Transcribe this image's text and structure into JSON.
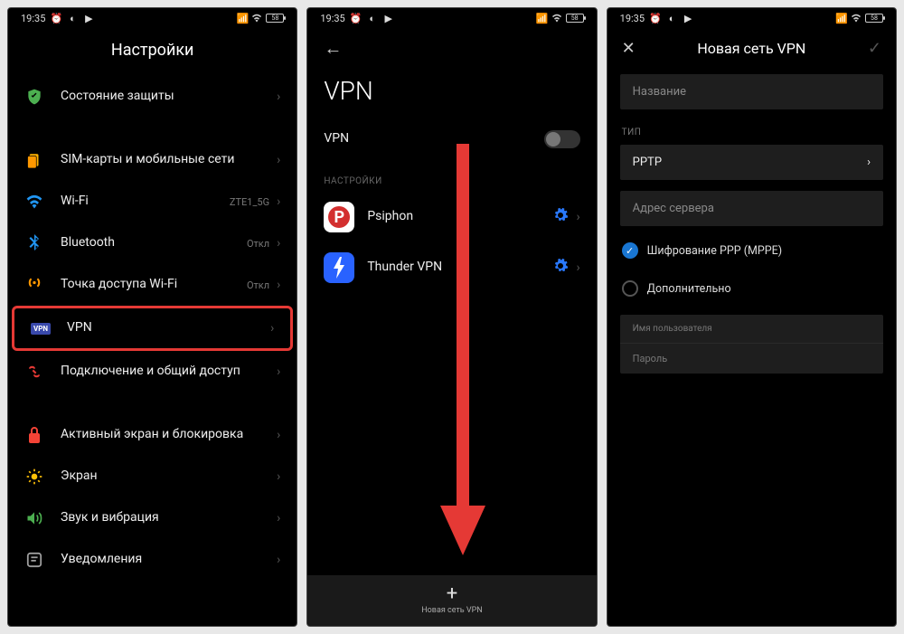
{
  "status": {
    "time": "19:35",
    "battery": "58"
  },
  "screen1": {
    "title": "Настройки",
    "items": [
      {
        "label": "Состояние защиты",
        "sub": ""
      },
      {
        "label": "SIM-карты и мобильные сети",
        "sub": ""
      },
      {
        "label": "Wi-Fi",
        "sub": "ZTE1_5G"
      },
      {
        "label": "Bluetooth",
        "sub": "Откл"
      },
      {
        "label": "Точка доступа Wi-Fi",
        "sub": "Откл"
      },
      {
        "label": "VPN",
        "sub": ""
      },
      {
        "label": "Подключение и общий доступ",
        "sub": ""
      },
      {
        "label": "Активный экран и блокировка",
        "sub": ""
      },
      {
        "label": "Экран",
        "sub": ""
      },
      {
        "label": "Звук и вибрация",
        "sub": ""
      },
      {
        "label": "Уведомления",
        "sub": ""
      }
    ]
  },
  "screen2": {
    "title": "VPN",
    "toggle_label": "VPN",
    "section": "НАСТРОЙКИ",
    "apps": [
      {
        "name": "Psiphon"
      },
      {
        "name": "Thunder VPN"
      }
    ],
    "add_caption": "Новая сеть VPN"
  },
  "screen3": {
    "title": "Новая сеть VPN",
    "name_placeholder": "Название",
    "type_label": "ТИП",
    "type_value": "PPTP",
    "server_placeholder": "Адрес сервера",
    "encrypt_label": "Шифрование PPP (MPPE)",
    "advanced_label": "Дополнительно",
    "user_label": "Имя пользователя",
    "pass_label": "Пароль"
  }
}
